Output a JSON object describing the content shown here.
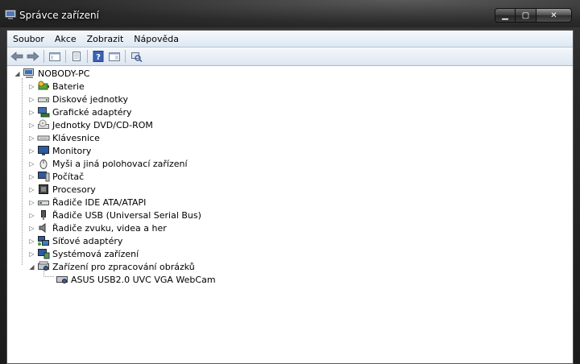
{
  "window": {
    "title": "Správce zařízení",
    "min_glyph": "▁",
    "max_glyph": "▢",
    "close_glyph": "✕"
  },
  "menu": [
    {
      "label": "Soubor"
    },
    {
      "label": "Akce"
    },
    {
      "label": "Zobrazit"
    },
    {
      "label": "Nápověda"
    }
  ],
  "toolbar": {
    "icons": [
      "back-arrow-icon",
      "forward-arrow-icon",
      "show-hide-console-tree-icon",
      "properties-icon",
      "help-icon",
      "view-icon",
      "scan-hardware-icon"
    ]
  },
  "tree": {
    "root": {
      "label": "NOBODY-PC",
      "expanded": true,
      "icon": "computer-icon"
    },
    "categories": [
      {
        "label": "Baterie",
        "icon": "battery-icon",
        "expanded": false
      },
      {
        "label": "Diskové jednotky",
        "icon": "disk-drive-icon",
        "expanded": false
      },
      {
        "label": "Grafické adaptéry",
        "icon": "display-adapter-icon",
        "expanded": false
      },
      {
        "label": "Jednotky DVD/CD-ROM",
        "icon": "dvd-drive-icon",
        "expanded": false
      },
      {
        "label": "Klávesnice",
        "icon": "keyboard-icon",
        "expanded": false
      },
      {
        "label": "Monitory",
        "icon": "monitor-icon",
        "expanded": false
      },
      {
        "label": "Myši a jiná polohovací zařízení",
        "icon": "mouse-icon",
        "expanded": false
      },
      {
        "label": "Počítač",
        "icon": "computer-icon",
        "expanded": false
      },
      {
        "label": "Procesory",
        "icon": "processor-icon",
        "expanded": false
      },
      {
        "label": "Řadiče IDE ATA/ATAPI",
        "icon": "ide-controller-icon",
        "expanded": false
      },
      {
        "label": "Řadiče USB (Universal Serial Bus)",
        "icon": "usb-controller-icon",
        "expanded": false
      },
      {
        "label": "Řadiče zvuku, videa a her",
        "icon": "sound-icon",
        "expanded": false
      },
      {
        "label": "Síťové adaptéry",
        "icon": "network-adapter-icon",
        "expanded": false
      },
      {
        "label": "Systémová zařízení",
        "icon": "system-device-icon",
        "expanded": false
      },
      {
        "label": "Zařízení pro zpracování obrázků",
        "icon": "imaging-device-icon",
        "expanded": true
      }
    ],
    "children_of_imaging": [
      {
        "label": "ASUS USB2.0 UVC VGA WebCam",
        "icon": "webcam-icon"
      }
    ]
  }
}
